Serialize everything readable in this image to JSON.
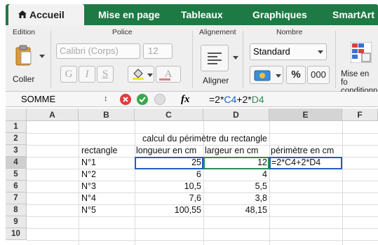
{
  "ribbon": {
    "tabs": [
      "Accueil",
      "Mise en page",
      "Tableaux",
      "Graphiques",
      "SmartArt"
    ],
    "groups": {
      "edition": "Edition",
      "police": "Police",
      "alignement": "Alignement",
      "nombre": "Nombre"
    },
    "paste_label": "Coller",
    "font_name": "Calibri (Corps)",
    "font_size": "12",
    "bold": "G",
    "italic": "I",
    "underline": "S",
    "font_color_letter": "A",
    "align_label": "Aligner",
    "number_format": "Standard",
    "percent": "%",
    "thousands": "000",
    "conditional_label_1": "Mise en fo",
    "conditional_label_2": "conditionn"
  },
  "formula_bar": {
    "name_box": "SOMME",
    "fx": "fx",
    "formula_prefix": "=2*",
    "formula_ref1": "C4",
    "formula_mid": "+2*",
    "formula_ref2": "D4"
  },
  "sheet": {
    "columns": [
      "A",
      "B",
      "C",
      "D",
      "E",
      "F"
    ],
    "rows": [
      "1",
      "2",
      "3",
      "4",
      "5",
      "6",
      "7",
      "8",
      "9",
      "10"
    ],
    "title": "calcul du périmètre du rectangle",
    "headers": {
      "rectangle": "rectangle",
      "longueur": "longueur en cm",
      "largeur": "largeur en cm",
      "perimetre": "périmètre en cm"
    },
    "data": [
      {
        "name": "N°1",
        "longueur": "25",
        "largeur": "12"
      },
      {
        "name": "N°2",
        "longueur": "6",
        "largeur": "4"
      },
      {
        "name": "N°3",
        "longueur": "10,5",
        "largeur": "5,5"
      },
      {
        "name": "N°4",
        "longueur": "7,6",
        "largeur": "3,8"
      },
      {
        "name": "N°5",
        "longueur": "100,55",
        "largeur": "48,15"
      }
    ],
    "editing_formula": "=2*C4+2*D4"
  },
  "colors": {
    "ribbon_green": "#1d7a45",
    "ref_c4": "#1f5fbf",
    "ref_d4": "#2e8b57"
  }
}
